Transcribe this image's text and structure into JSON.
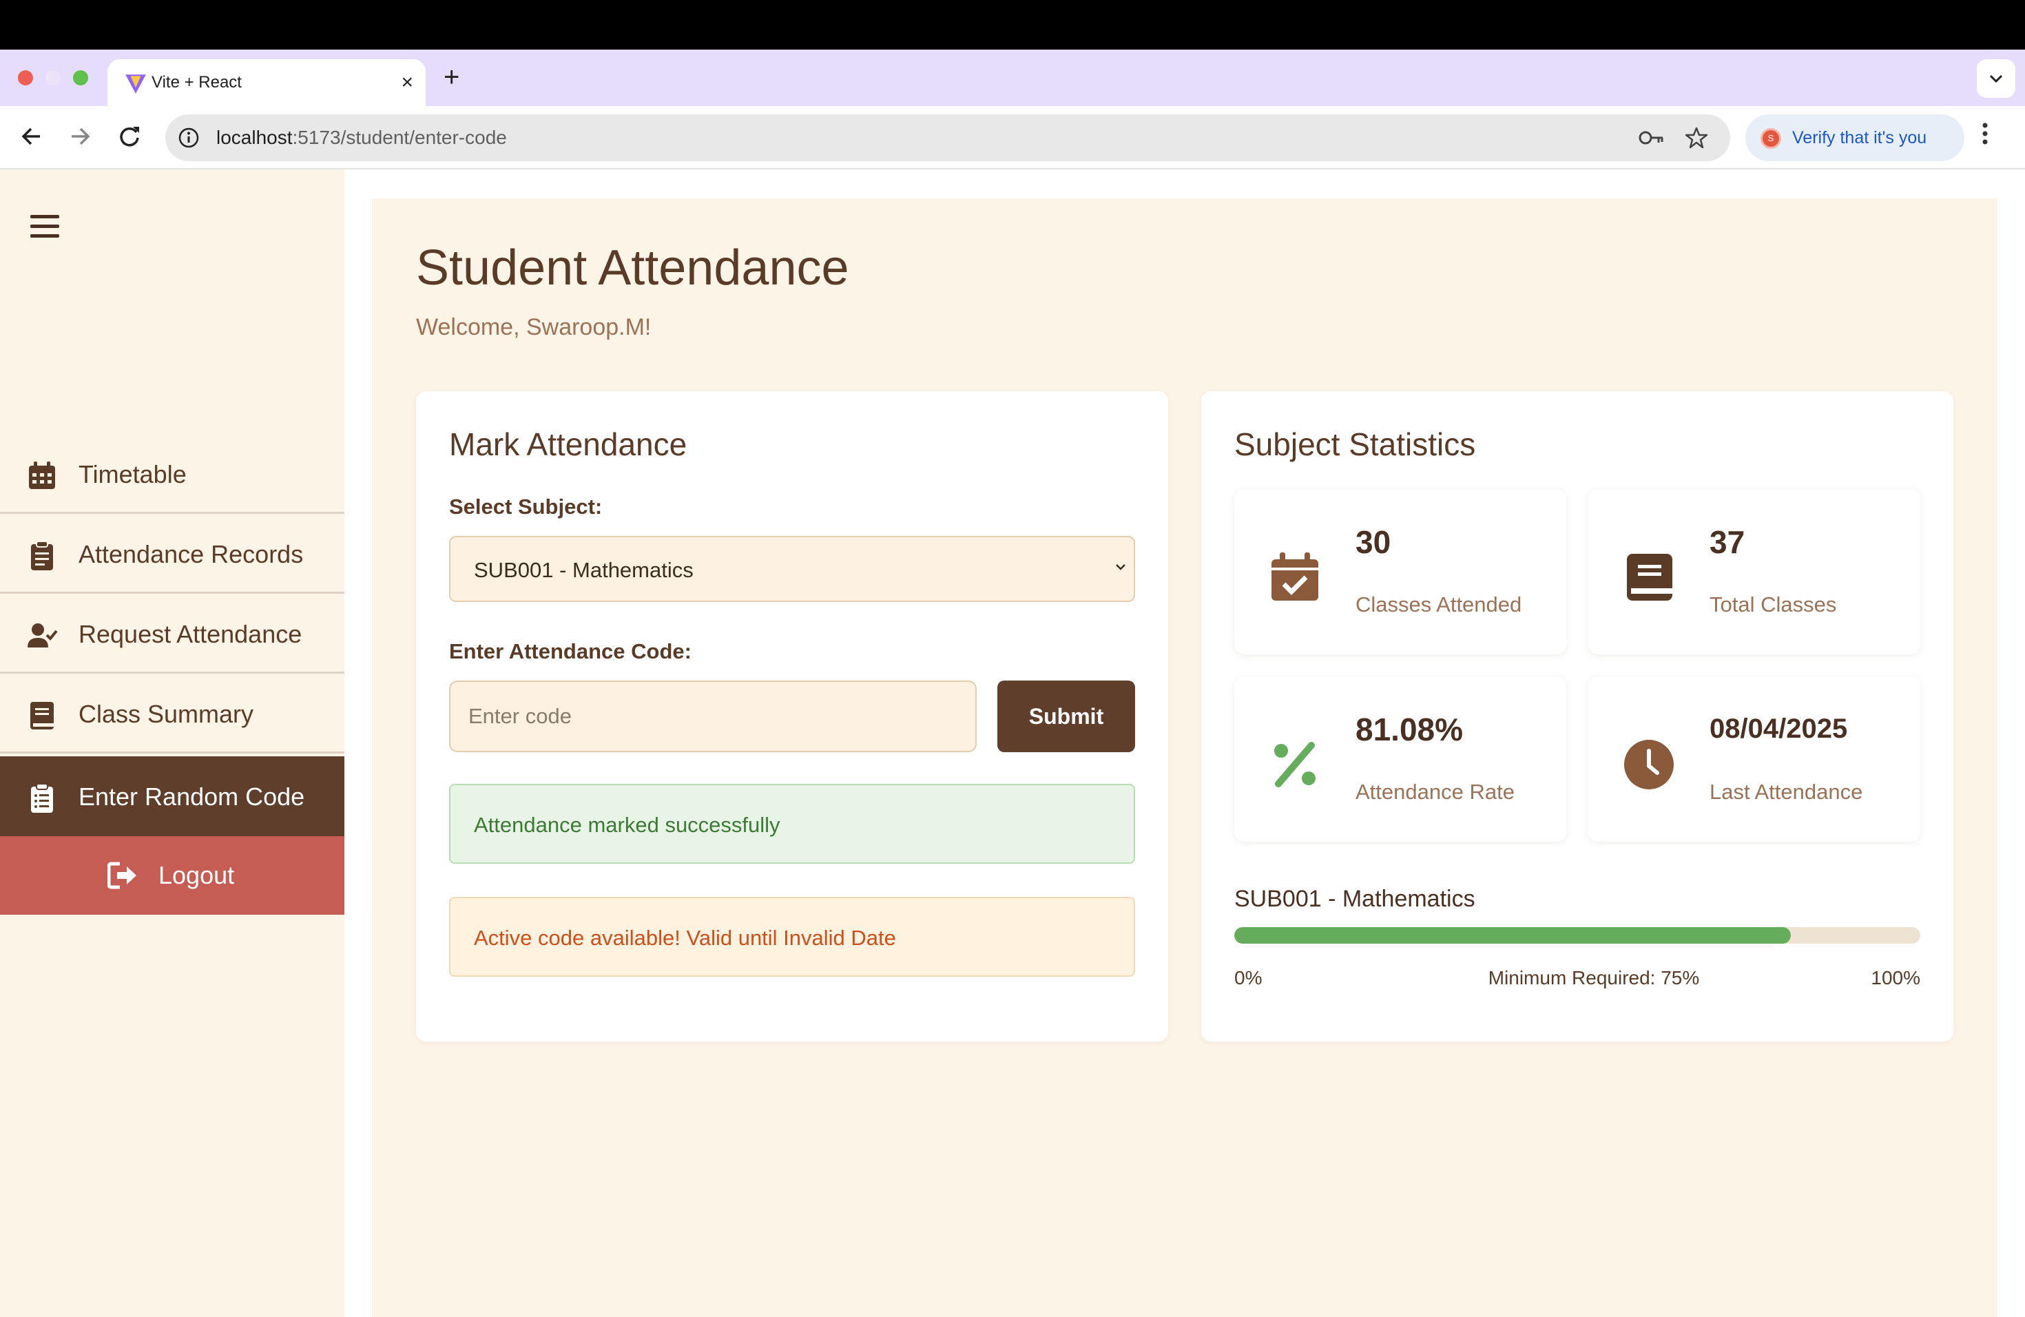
{
  "browser": {
    "tab_title": "Vite + React",
    "new_tab_glyph": "+",
    "close_glyph": "×",
    "url_host": "localhost",
    "url_rest": ":5173/student/enter-code",
    "verify_label": "Verify that it's you",
    "profile_initial": "S"
  },
  "sidebar": {
    "items": [
      {
        "label": "Timetable",
        "icon": "calendar-icon"
      },
      {
        "label": "Attendance Records",
        "icon": "clipboard-icon"
      },
      {
        "label": "Request Attendance",
        "icon": "user-check-icon"
      },
      {
        "label": "Class Summary",
        "icon": "book-icon"
      },
      {
        "label": "Enter Random Code",
        "icon": "clipboard-list-icon",
        "active": true
      }
    ],
    "logout_label": "Logout"
  },
  "header": {
    "title": "Student Attendance",
    "welcome": "Welcome, Swaroop.M!"
  },
  "mark_attendance": {
    "title": "Mark Attendance",
    "subject_label": "Select Subject:",
    "subject_value": "SUB001 - Mathematics",
    "code_label": "Enter Attendance Code:",
    "code_placeholder": "Enter code",
    "code_value": "",
    "submit_label": "Submit",
    "success_message": "Attendance marked successfully",
    "active_message": "Active code available! Valid until Invalid Date"
  },
  "subject_statistics": {
    "title": "Subject Statistics",
    "stats": [
      {
        "value": "30",
        "caption": "Classes Attended",
        "icon": "calendar-check-icon"
      },
      {
        "value": "37",
        "caption": "Total Classes",
        "icon": "book-icon"
      },
      {
        "value": "81.08%",
        "caption": "Attendance Rate",
        "icon": "percent-icon"
      },
      {
        "value": "08/04/2025",
        "caption": "Last Attendance",
        "icon": "clock-icon"
      }
    ],
    "progress_subject": "SUB001 - Mathematics",
    "progress_percent": 81.08,
    "progress_min_label": "0%",
    "progress_required_label": "Minimum Required: 75%",
    "progress_max_label": "100%"
  },
  "colors": {
    "brown": "#5f3e2c",
    "cream": "#fdf4e8",
    "logout_red": "#c65d55",
    "green": "#65ad5d",
    "success_text": "#3c7a35",
    "warning_text": "#cc4f1c"
  }
}
